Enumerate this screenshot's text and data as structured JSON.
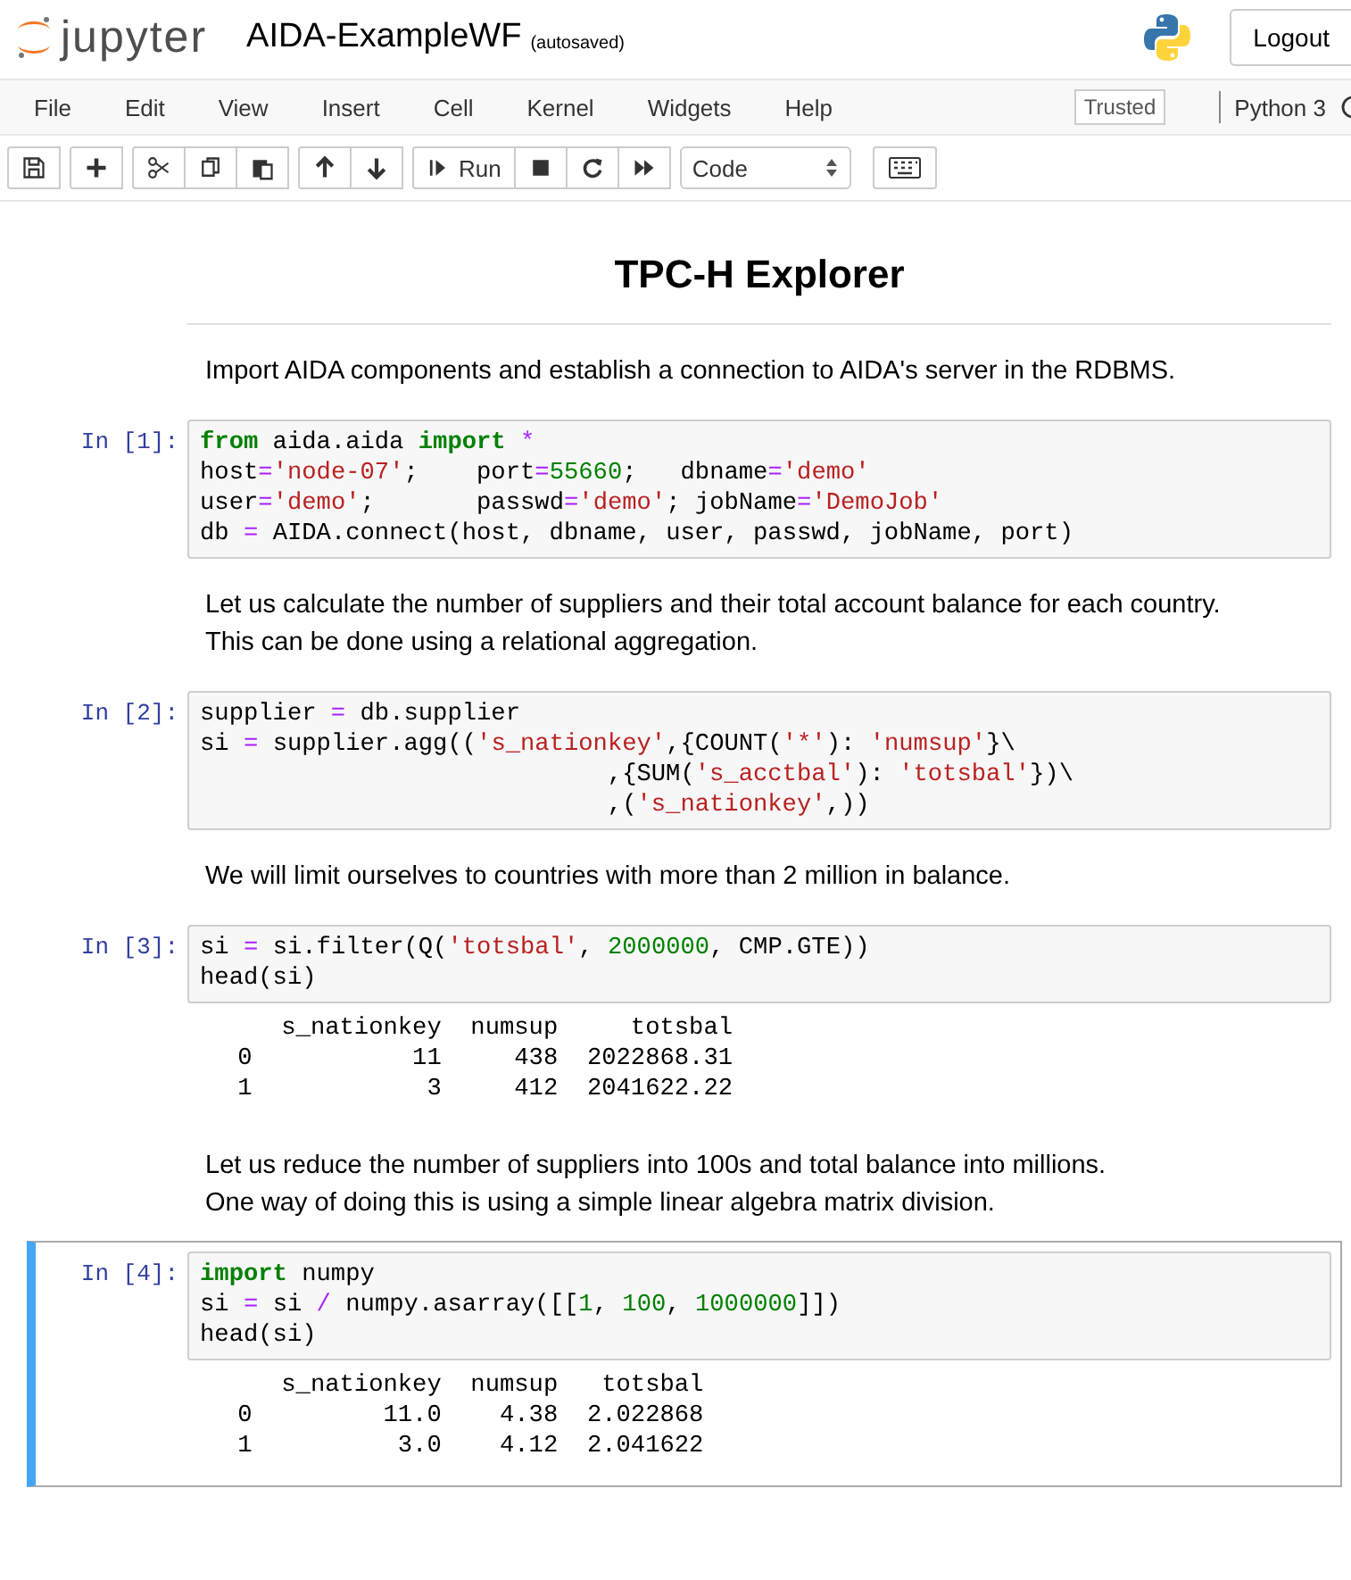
{
  "header": {
    "logo_text": "jupyter",
    "notebook_name": "AIDA-ExampleWF",
    "save_status": "(autosaved)",
    "logout": "Logout"
  },
  "menubar": {
    "items": [
      "File",
      "Edit",
      "View",
      "Insert",
      "Cell",
      "Kernel",
      "Widgets",
      "Help"
    ],
    "trusted": "Trusted",
    "kernel_name": "Python 3"
  },
  "toolbar": {
    "groups": [
      [
        {
          "kind": "save"
        }
      ],
      [
        {
          "kind": "add"
        }
      ],
      [
        {
          "kind": "cut"
        },
        {
          "kind": "copy"
        },
        {
          "kind": "paste"
        }
      ],
      [
        {
          "kind": "up"
        },
        {
          "kind": "down"
        }
      ],
      [
        {
          "kind": "run",
          "label": "Run"
        },
        {
          "kind": "stop"
        },
        {
          "kind": "restart"
        },
        {
          "kind": "fastforward"
        }
      ]
    ],
    "cell_type": "Code"
  },
  "cells": [
    {
      "kind": "heading",
      "selected": false,
      "text": "TPC-H Explorer"
    },
    {
      "kind": "markdown",
      "selected": false,
      "lines": [
        "Import AIDA components and establish a connection to AIDA's server in the RDBMS."
      ]
    },
    {
      "kind": "code",
      "selected": false,
      "prompt": "In [1]:",
      "lines": [
        [
          {
            "kind": "kw",
            "text": "from"
          },
          {
            "kind": "p",
            "text": " aida.aida "
          },
          {
            "kind": "kw",
            "text": "import"
          },
          {
            "kind": "op",
            "text": " *"
          }
        ],
        [
          {
            "kind": "p",
            "text": "host"
          },
          {
            "kind": "op",
            "text": "="
          },
          {
            "kind": "str",
            "text": "'node-07'"
          },
          {
            "kind": "p",
            "text": ";    port"
          },
          {
            "kind": "op",
            "text": "="
          },
          {
            "kind": "num",
            "text": "55660"
          },
          {
            "kind": "p",
            "text": ";   dbname"
          },
          {
            "kind": "op",
            "text": "="
          },
          {
            "kind": "str",
            "text": "'demo'"
          }
        ],
        [
          {
            "kind": "p",
            "text": "user"
          },
          {
            "kind": "op",
            "text": "="
          },
          {
            "kind": "str",
            "text": "'demo'"
          },
          {
            "kind": "p",
            "text": ";       passwd"
          },
          {
            "kind": "op",
            "text": "="
          },
          {
            "kind": "str",
            "text": "'demo'"
          },
          {
            "kind": "p",
            "text": "; jobName"
          },
          {
            "kind": "op",
            "text": "="
          },
          {
            "kind": "str",
            "text": "'DemoJob'"
          }
        ],
        [
          {
            "kind": "p",
            "text": "db "
          },
          {
            "kind": "op",
            "text": "="
          },
          {
            "kind": "p",
            "text": " AIDA.connect(host, dbname, user, passwd, jobName, port)"
          }
        ]
      ]
    },
    {
      "kind": "markdown",
      "selected": false,
      "lines": [
        "Let us calculate the number of suppliers and their total account balance for each country.",
        "This can be done using a relational aggregation."
      ]
    },
    {
      "kind": "code",
      "selected": false,
      "prompt": "In [2]:",
      "lines": [
        [
          {
            "kind": "p",
            "text": "supplier "
          },
          {
            "kind": "op",
            "text": "="
          },
          {
            "kind": "p",
            "text": " db.supplier"
          }
        ],
        [
          {
            "kind": "p",
            "text": "si "
          },
          {
            "kind": "op",
            "text": "="
          },
          {
            "kind": "p",
            "text": " supplier.agg(("
          },
          {
            "kind": "str",
            "text": "'s_nationkey'"
          },
          {
            "kind": "p",
            "text": ",{COUNT("
          },
          {
            "kind": "str",
            "text": "'*'"
          },
          {
            "kind": "p",
            "text": "): "
          },
          {
            "kind": "str",
            "text": "'numsup'"
          },
          {
            "kind": "p",
            "text": "}\\"
          }
        ],
        [
          {
            "kind": "p",
            "text": "                            ,{SUM("
          },
          {
            "kind": "str",
            "text": "'s_acctbal'"
          },
          {
            "kind": "p",
            "text": "): "
          },
          {
            "kind": "str",
            "text": "'totsbal'"
          },
          {
            "kind": "p",
            "text": "})\\"
          }
        ],
        [
          {
            "kind": "p",
            "text": "                            ,("
          },
          {
            "kind": "str",
            "text": "'s_nationkey'"
          },
          {
            "kind": "p",
            "text": ",))"
          }
        ]
      ]
    },
    {
      "kind": "markdown",
      "selected": false,
      "lines": [
        "We will limit ourselves to countries with more than 2 million in balance."
      ]
    },
    {
      "kind": "code",
      "selected": false,
      "prompt": "In [3]:",
      "lines": [
        [
          {
            "kind": "p",
            "text": "si "
          },
          {
            "kind": "op",
            "text": "="
          },
          {
            "kind": "p",
            "text": " si.filter(Q("
          },
          {
            "kind": "str",
            "text": "'totsbal'"
          },
          {
            "kind": "p",
            "text": ", "
          },
          {
            "kind": "num",
            "text": "2000000"
          },
          {
            "kind": "p",
            "text": ", CMP.GTE))"
          }
        ],
        [
          {
            "kind": "p",
            "text": "head(si)"
          }
        ]
      ],
      "output": [
        "    s_nationkey  numsup     totsbal",
        " 0           11     438  2022868.31",
        " 1            3     412  2041622.22"
      ]
    },
    {
      "kind": "markdown",
      "selected": false,
      "lines": [
        "Let us reduce the number of suppliers into 100s and total balance into millions.",
        "One way of doing this is using a simple linear algebra matrix division."
      ]
    },
    {
      "kind": "code",
      "selected": true,
      "prompt": "In [4]:",
      "lines": [
        [
          {
            "kind": "kw",
            "text": "import"
          },
          {
            "kind": "p",
            "text": " numpy"
          }
        ],
        [
          {
            "kind": "p",
            "text": "si "
          },
          {
            "kind": "op",
            "text": "="
          },
          {
            "kind": "p",
            "text": " si "
          },
          {
            "kind": "op",
            "text": "/"
          },
          {
            "kind": "p",
            "text": " numpy.asarray([["
          },
          {
            "kind": "num",
            "text": "1"
          },
          {
            "kind": "p",
            "text": ", "
          },
          {
            "kind": "num",
            "text": "100"
          },
          {
            "kind": "p",
            "text": ", "
          },
          {
            "kind": "num",
            "text": "1000000"
          },
          {
            "kind": "p",
            "text": "]])"
          }
        ],
        [
          {
            "kind": "p",
            "text": "head(si)"
          }
        ]
      ],
      "output": [
        "    s_nationkey  numsup   totsbal",
        " 0         11.0    4.38  2.022868",
        " 1          3.0    4.12  2.041622"
      ]
    }
  ]
}
